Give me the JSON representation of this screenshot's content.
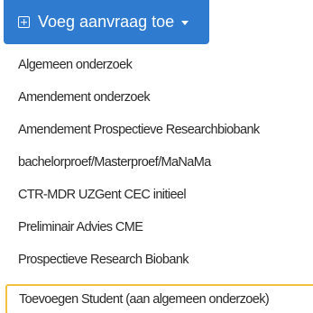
{
  "toolbar": {
    "add_label": "Voeg aanvraag toe",
    "add_icon": "plus-square-icon",
    "caret_icon": "caret-down-icon",
    "button_color": "#2f7bd0"
  },
  "menu": {
    "items": [
      {
        "label": "Algemeen onderzoek"
      },
      {
        "label": "Amendement onderzoek"
      },
      {
        "label": "Amendement Prospectieve Researchbiobank"
      },
      {
        "label": "bachelorproef/Masterproef/MaNaMa"
      },
      {
        "label": "CTR-MDR UZGent CEC initieel"
      },
      {
        "label": "Preliminair Advies CME"
      },
      {
        "label": "Prospectieve Research Biobank"
      },
      {
        "label": "Toevoegen Student (aan algemeen onderzoek)"
      }
    ],
    "highlight_color": "#f3c23c"
  }
}
